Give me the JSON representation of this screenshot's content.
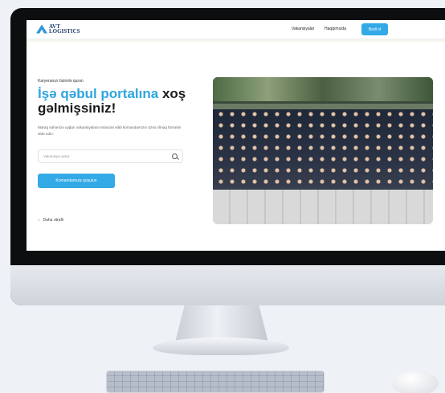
{
  "brand": {
    "line1": "AVT",
    "line2": "LOGISTICS"
  },
  "nav": {
    "vacancies": "Vakansiyalar",
    "about": "Haqqımızda",
    "apply": "Bədl ol"
  },
  "hero": {
    "kicker": "Karyeranızı bizimlə qurun",
    "title_accent": "İşə qəbul portalına",
    "title_rest_1": "xoş",
    "title_rest_2": "gəlmişsiniz!",
    "desc": "Maraq sahənizə uyğun vakansiyalara müraciət edib komandamızın üzvü olmaq fürsətini əldə edin.",
    "search_placeholder": "Vakansiya axtar",
    "cta": "Komandamıza qoşulun",
    "more": "Daha ətraflı"
  },
  "icons": {
    "search": "search-icon",
    "arrow": "arrow-down-icon",
    "logo": "logo-mark-icon"
  },
  "colors": {
    "accent": "#33a9e6",
    "title": "#1b1b1b"
  }
}
